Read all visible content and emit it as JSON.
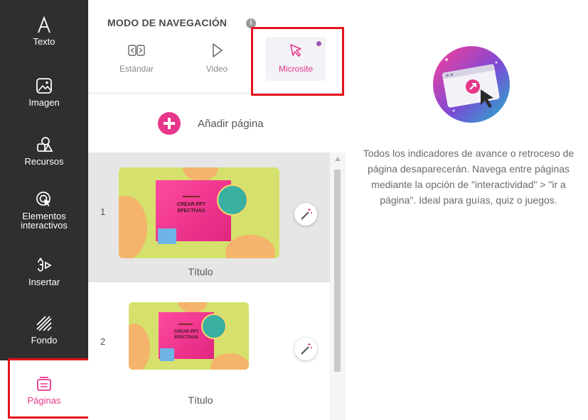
{
  "sidebar": {
    "items": [
      {
        "label": "Texto",
        "icon": "text-icon"
      },
      {
        "label": "Imagen",
        "icon": "image-icon"
      },
      {
        "label": "Recursos",
        "icon": "shapes-icon"
      },
      {
        "label": "Elementos\ninteractivos",
        "icon": "interactive-icon"
      },
      {
        "label": "Insertar",
        "icon": "insert-icon"
      },
      {
        "label": "Fondo",
        "icon": "background-icon"
      },
      {
        "label": "Páginas",
        "icon": "pages-icon"
      }
    ],
    "active": "Páginas"
  },
  "navigation_mode": {
    "title": "MODO DE NAVEGACIÓN",
    "info_icon": "i",
    "options": [
      {
        "label": "Estándar",
        "icon": "arrows-icon"
      },
      {
        "label": "Video",
        "icon": "play-icon"
      },
      {
        "label": "Microsite",
        "icon": "cursor-icon"
      }
    ],
    "selected": "Microsite"
  },
  "add_page": {
    "label": "Añadir página"
  },
  "pages": [
    {
      "number": "1",
      "title": "Título",
      "thumb_text": "CREAR PPT\nEFECTIVAS"
    },
    {
      "number": "2",
      "title": "Título",
      "thumb_text": "CREAR PPT\nEFECTIVAS"
    }
  ],
  "info": {
    "description": "Todos los indicadores de avance o retroceso de página desaparecerán. Navega entre páginas mediante la opción de \"interactividad\" > \"ir a página\". Ideal para guías, quiz o juegos."
  },
  "colors": {
    "accent": "#e7378b",
    "sidebar": "#2f2f2f",
    "highlight_frame": "#e3141d"
  }
}
